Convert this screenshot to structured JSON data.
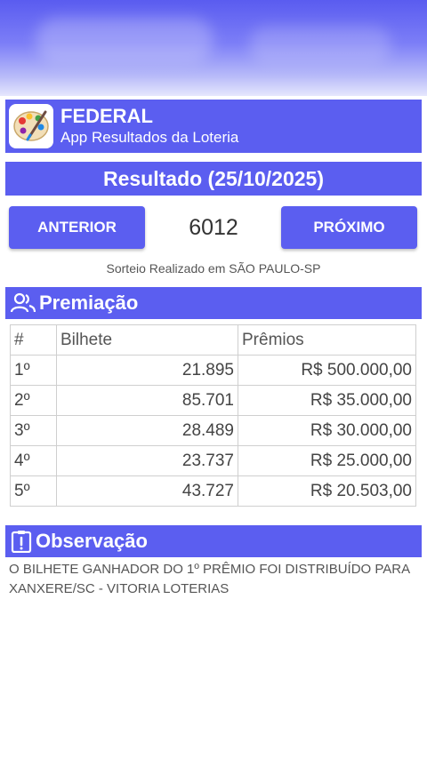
{
  "header": {
    "title": "FEDERAL",
    "subtitle": "App Resultados da Loteria",
    "icon": "lottery-palette-icon"
  },
  "result": {
    "title": "Resultado (25/10/2025)"
  },
  "navigation": {
    "prev_label": "ANTERIOR",
    "next_label": "PRÓXIMO",
    "contest_number": "6012"
  },
  "draw_location": "Sorteio Realizado em SÃO PAULO-SP",
  "prizes": {
    "section_title": "Premiação",
    "icon": "people-icon",
    "columns": [
      "#",
      "Bilhete",
      "Prêmios"
    ],
    "rows": [
      {
        "pos": "1º",
        "ticket": "21.895",
        "prize": "R$ 500.000,00"
      },
      {
        "pos": "2º",
        "ticket": "85.701",
        "prize": "R$ 35.000,00"
      },
      {
        "pos": "3º",
        "ticket": "28.489",
        "prize": "R$ 30.000,00"
      },
      {
        "pos": "4º",
        "ticket": "23.737",
        "prize": "R$ 25.000,00"
      },
      {
        "pos": "5º",
        "ticket": "43.727",
        "prize": "R$ 20.503,00"
      }
    ]
  },
  "observation": {
    "section_title": "Observação",
    "icon": "clipboard-alert-icon",
    "text": "O BILHETE GANHADOR DO 1º PRÊMIO FOI DISTRIBUÍDO PARA XANXERE/SC - VITORIA LOTERIAS"
  },
  "colors": {
    "primary": "#5b5ef0",
    "text": "#333333"
  }
}
